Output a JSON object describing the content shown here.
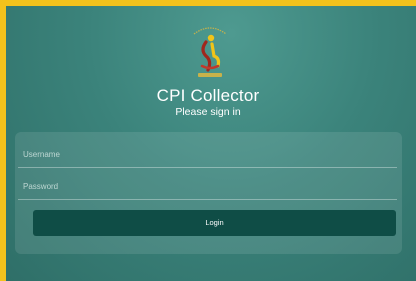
{
  "app": {
    "logo_name": "statistical-office-logo-icon",
    "title": "CPI Collector",
    "subtitle": "Please sign in"
  },
  "form": {
    "username_placeholder": "Username",
    "password_placeholder": "Password",
    "login_label": "Login"
  },
  "colors": {
    "border": "#f3c21c",
    "background": "#3b837b",
    "button": "#0f4d46",
    "text": "#ffffff"
  }
}
